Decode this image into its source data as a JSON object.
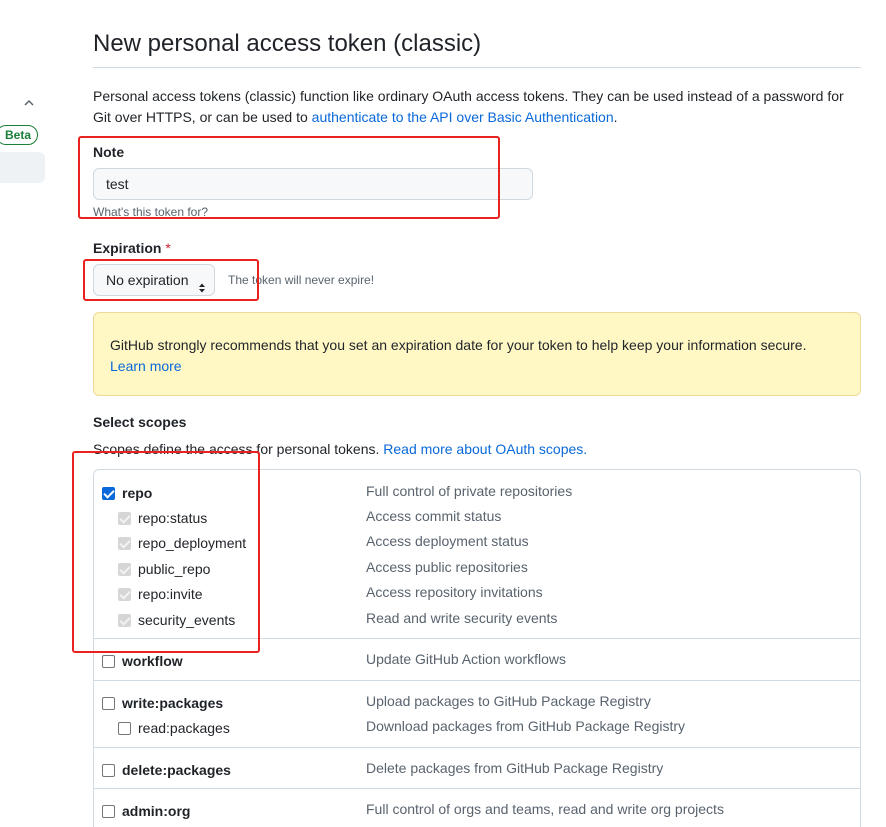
{
  "sidebar": {
    "beta_label": "Beta"
  },
  "page": {
    "title": "New personal access token (classic)",
    "intro_text": "Personal access tokens (classic) function like ordinary OAuth access tokens. They can be used instead of a password for Git over HTTPS, or can be used to ",
    "intro_link": "authenticate to the API over Basic Authentication",
    "intro_end": "."
  },
  "note": {
    "label": "Note",
    "value": "test",
    "hint": "What's this token for?"
  },
  "expiration": {
    "label": "Expiration",
    "required_mark": "*",
    "selected": "No expiration",
    "message": "The token will never expire!"
  },
  "flash": {
    "text": "GitHub strongly recommends that you set an expiration date for your token to help keep your information secure.",
    "link": "Learn more"
  },
  "scopes": {
    "heading": "Select scopes",
    "desc_text": "Scopes define the access for personal tokens. ",
    "desc_link": "Read more about OAuth scopes.",
    "groups": [
      {
        "name": "repo",
        "desc": "Full control of private repositories",
        "checked": true,
        "children": [
          {
            "name": "repo:status",
            "desc": "Access commit status"
          },
          {
            "name": "repo_deployment",
            "desc": "Access deployment status"
          },
          {
            "name": "public_repo",
            "desc": "Access public repositories"
          },
          {
            "name": "repo:invite",
            "desc": "Access repository invitations"
          },
          {
            "name": "security_events",
            "desc": "Read and write security events"
          }
        ]
      },
      {
        "name": "workflow",
        "desc": "Update GitHub Action workflows",
        "checked": false
      },
      {
        "name": "write:packages",
        "desc": "Upload packages to GitHub Package Registry",
        "checked": false,
        "children": [
          {
            "name": "read:packages",
            "desc": "Download packages from GitHub Package Registry"
          }
        ]
      },
      {
        "name": "delete:packages",
        "desc": "Delete packages from GitHub Package Registry",
        "checked": false
      },
      {
        "name": "admin:org",
        "desc": "Full control of orgs and teams, read and write org projects",
        "checked": false
      }
    ]
  },
  "colors": {
    "accent": "#0969da",
    "annotation": "#e8231f",
    "flash_bg": "#fff8c5"
  }
}
